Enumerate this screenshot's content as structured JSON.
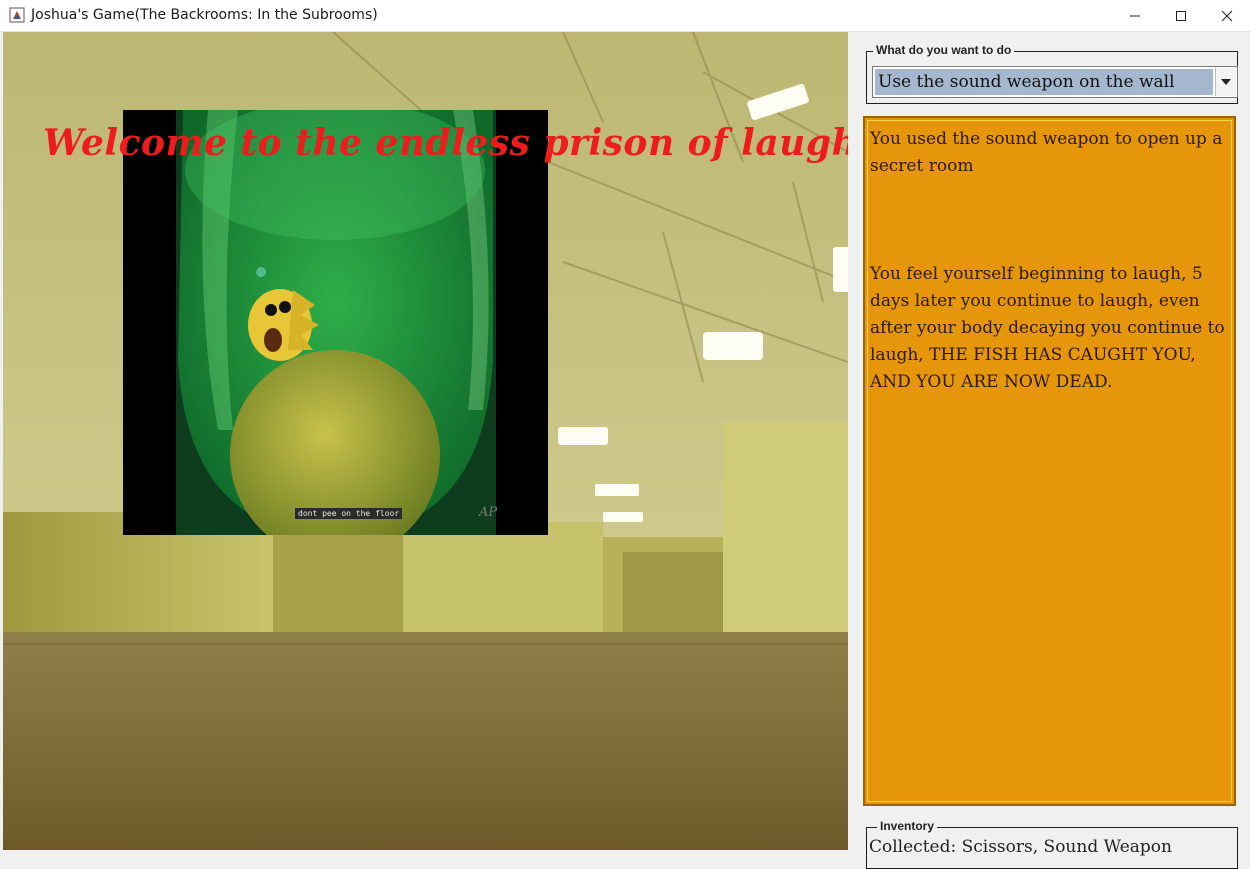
{
  "window": {
    "title": "Joshua's Game(The Backrooms: In the Subrooms)",
    "controls": [
      "minimize",
      "maximize",
      "close"
    ]
  },
  "scene": {
    "overlay_text": "Welcome to the endless prison of laughter",
    "image": {
      "subtitle": "dont pee on the floor",
      "watermark": "AP"
    }
  },
  "panel": {
    "action": {
      "legend": "What do you want to do",
      "selected": "Use the sound weapon on the wall"
    },
    "story": {
      "paragraph1": "You used the sound weapon to open up a secret room",
      "paragraph2": "You feel yourself beginning to laugh, 5 days later you continue to laugh, even after your body decaying you continue to laugh, THE FISH HAS CAUGHT YOU, AND YOU ARE NOW DEAD."
    },
    "inventory": {
      "legend": "Inventory",
      "text": "Collected: Scissors, Sound Weapon"
    }
  },
  "colors": {
    "overlay_text": "#ee1c1c",
    "story_background": "#e6960b",
    "combo_selection": "#a5b7cf"
  }
}
